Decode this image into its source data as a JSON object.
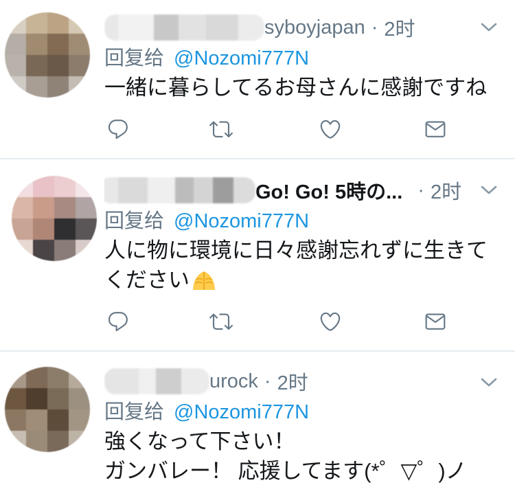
{
  "theme": {
    "text": "#14171a",
    "secondary": "#657786",
    "link": "#1b95e0",
    "icon": "#657786",
    "divider": "#e6ecf0"
  },
  "tweets": [
    {
      "author": {
        "name_visible": "syboyjapan",
        "avatar_pixels": [
          "#d8cfc3",
          "#c7b497",
          "#bba383",
          "#d6c9b3",
          "#b4aea6",
          "#a08a70",
          "#826b52",
          "#a08c74",
          "#b8b2aa",
          "#7a6856",
          "#6a5848",
          "#8c7c6c",
          "#cfcac4",
          "#a89e94",
          "#8f8378",
          "#c4bcb2"
        ]
      },
      "separator": "·",
      "time": "2时",
      "menu_icon": "chevron-down",
      "reply_prefix": "回复给",
      "reply_to": "@Nozomi777N",
      "text_lines": [
        "一緒に暮らしてるお母さんに感謝ですね"
      ],
      "actions": [
        "reply",
        "retweet",
        "like",
        "direct-message"
      ]
    },
    {
      "author": {
        "display_name_visible": "Go! Go! 5時の...",
        "avatar_pixels": [
          "#f2dde0",
          "#e8c2c6",
          "#eccdd0",
          "#f4e6e8",
          "#d9b6a6",
          "#c99c8a",
          "#a88a82",
          "#b0a4a4",
          "#c8a494",
          "#b08676",
          "#2f2f31",
          "#5a5657",
          "#e8d8d2",
          "#4a4446",
          "#8a7c78",
          "#d8ccc8"
        ]
      },
      "separator": "·",
      "time": "2时",
      "menu_icon": "chevron-down",
      "reply_prefix": "回复给",
      "reply_to": "@Nozomi777N",
      "text_lines": [
        "人に物に環境に日々感謝忘れずに生きて",
        "ください"
      ],
      "emoji": "folded-hands",
      "actions": [
        "reply",
        "retweet",
        "like",
        "direct-message"
      ]
    },
    {
      "author": {
        "name_visible": "urock",
        "avatar_pixels": [
          "#a89888",
          "#7e6a56",
          "#8c7c6a",
          "#b6aa9c",
          "#6d5741",
          "#4f3d2d",
          "#7a6a58",
          "#9c9080",
          "#8b7762",
          "#a08d78",
          "#5e4c3a",
          "#a29584",
          "#c7bdb2",
          "#9a8a78",
          "#7a6a5a",
          "#bdb4a8"
        ]
      },
      "separator": "·",
      "time": "2时",
      "menu_icon": "chevron-down",
      "reply_prefix": "回复给",
      "reply_to": "@Nozomi777N",
      "text_lines": [
        "強くなって下さい！",
        "ガンバレー！ 応援してます(*゜▽゜)ノ"
      ]
    }
  ]
}
